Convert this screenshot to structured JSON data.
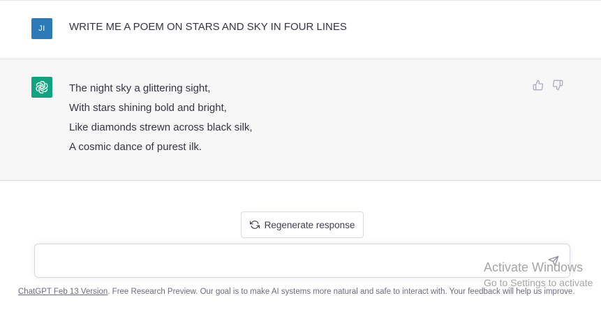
{
  "conversation": {
    "user": {
      "avatar_initials": "JI",
      "message": "WRITE ME A POEM ON STARS AND SKY IN FOUR LINES"
    },
    "assistant": {
      "avatar_icon": "openai-logo-icon",
      "lines": [
        "The night sky a glittering sight,",
        "With stars shining bold and bright,",
        "Like diamonds strewn across black silk,",
        "A cosmic dance of purest ilk."
      ],
      "feedback": {
        "thumbs_up_icon": "thumbs-up-icon",
        "thumbs_down_icon": "thumbs-down-icon"
      }
    }
  },
  "actions": {
    "regenerate_label": "Regenerate response",
    "regenerate_icon": "refresh-icon"
  },
  "composer": {
    "value": "",
    "placeholder": "",
    "send_icon": "send-icon"
  },
  "footer": {
    "version_link": "ChatGPT Feb 13 Version",
    "text": ". Free Research Preview. Our goal is to make AI systems more natural and safe to interact with. Your feedback will help us improve."
  },
  "watermark": {
    "title": "Activate Windows",
    "subtitle": "Go to Settings to activate"
  },
  "colors": {
    "user_avatar": "#2c7ab8",
    "assistant_avatar": "#10a37f",
    "assistant_bg": "#f7f7f8",
    "text": "#343541"
  }
}
